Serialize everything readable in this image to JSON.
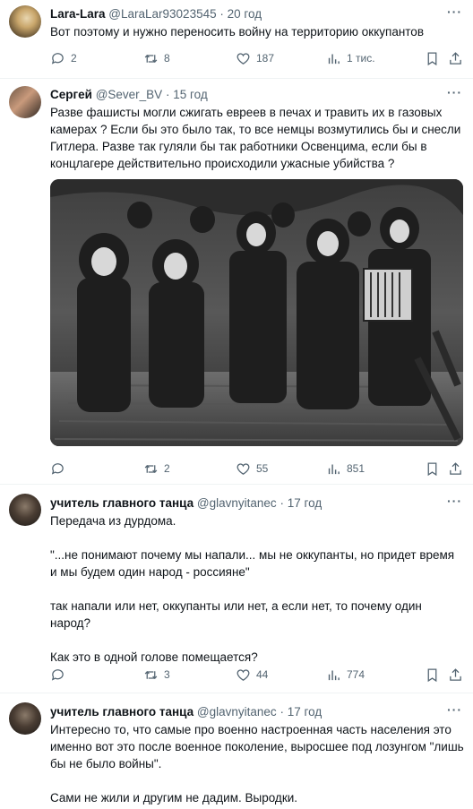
{
  "tweets": [
    {
      "name": "Lara-Lara",
      "handle": "@LaraLar93023545",
      "time": "20 год",
      "text": [
        "Вот поэтому и нужно переносить войну на территорию оккупантов"
      ],
      "replies": "2",
      "retweets": "8",
      "likes": "187",
      "views": "1 тис."
    },
    {
      "name": "Сергей",
      "handle": "@Sever_BV",
      "time": "15 год",
      "text": [
        "Разве фашисты могли сжигать евреев в печах и травить их в газовых камерах ? Если бы это было так, то все немцы возмутились бы и снесли Гитлера. Разве так гуляли бы так работники Освенцима, если бы в концлагере действительно происходили ужасные убийства ?"
      ],
      "replies": "",
      "retweets": "2",
      "likes": "55",
      "views": "851"
    },
    {
      "name": "учитель главного танца",
      "handle": "@glavnyitanec",
      "time": "17 год",
      "text": [
        "Передача из дурдома.",
        "\"...не понимают почему мы напали... мы не оккупанты, но придет время и мы будем один народ - россияне\"",
        "так напали или нет, оккупанты или нет, а если нет, то почему один народ?",
        "Как это в одной голове помещается?"
      ],
      "replies": "",
      "retweets": "3",
      "likes": "44",
      "views": "774"
    },
    {
      "name": "учитель главного танца",
      "handle": "@glavnyitanec",
      "time": "17 год",
      "text": [
        "Интересно то, что самые про военно настроенная часть населения это именно вот это после военное поколение, выросшее под лозунгом \"лишь бы не было войны\".",
        "Сами не жили и другим не дадим. Выродки."
      ]
    }
  ],
  "ui": {
    "more_glyph": "···",
    "sep": "·"
  },
  "colors": {
    "text": "#0f1419",
    "secondary": "#536471",
    "divider": "#eff3f4"
  },
  "icons": [
    "reply-icon",
    "retweet-icon",
    "like-icon",
    "views-icon",
    "bookmark-icon",
    "share-icon",
    "more-icon"
  ]
}
